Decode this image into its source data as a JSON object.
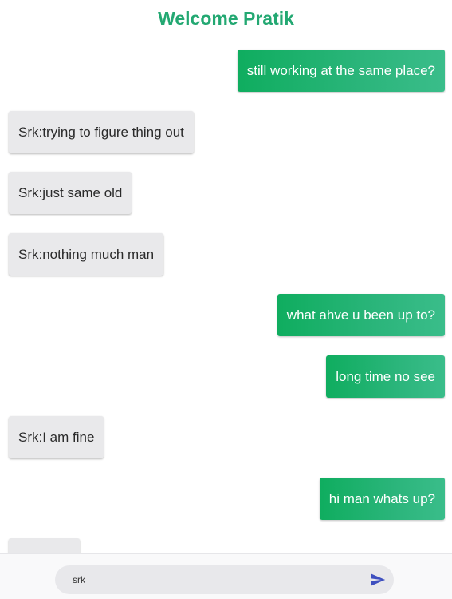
{
  "header": {
    "title": "Welcome Pratik"
  },
  "messages": [
    {
      "text": "still working at the same place?",
      "kind": "sent"
    },
    {
      "text": "Srk:trying to figure thing out",
      "kind": "received"
    },
    {
      "text": "Srk:just same old",
      "kind": "received"
    },
    {
      "text": "Srk:nothing much man",
      "kind": "received"
    },
    {
      "text": "what ahve u been up to?",
      "kind": "sent"
    },
    {
      "text": "long time no see",
      "kind": "sent"
    },
    {
      "text": "Srk:I am fine",
      "kind": "received"
    },
    {
      "text": "hi man whats up?",
      "kind": "sent"
    },
    {
      "text": "",
      "kind": "received"
    }
  ],
  "composer": {
    "value": "srk",
    "send_icon": "send-icon"
  },
  "colors": {
    "accent": "#23a872",
    "sent_bubble": "#10ad62",
    "received_bubble": "#e9e9eb",
    "send_icon": "#3e4fbf"
  }
}
